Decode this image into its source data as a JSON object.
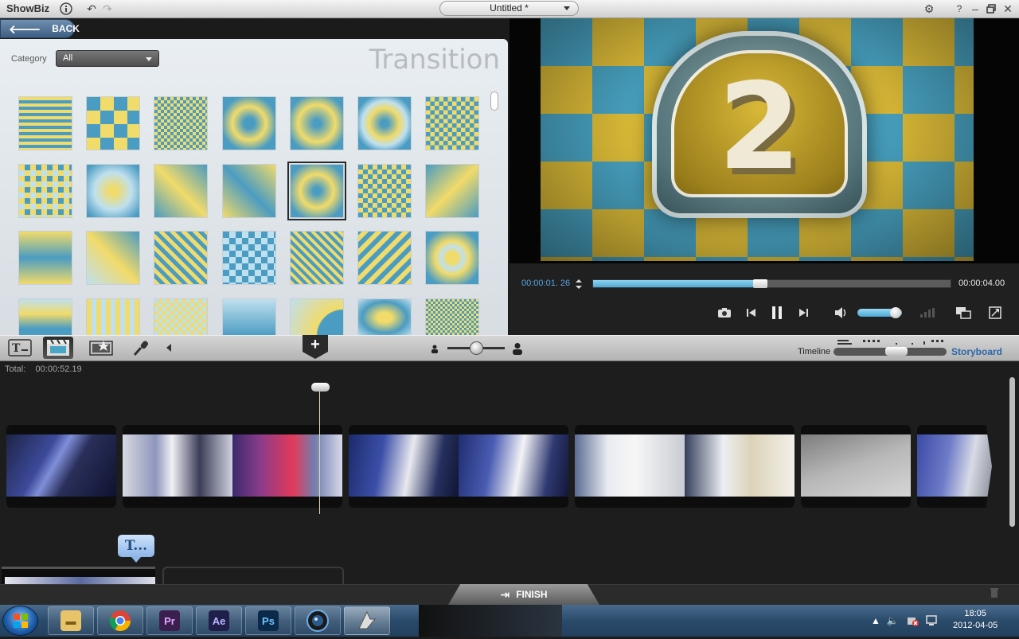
{
  "app": {
    "name": "ShowBiz",
    "document_title": "Untitled *"
  },
  "library": {
    "back_label": "BACK",
    "category_label": "Category",
    "category_value": "All",
    "section_title": "Transition",
    "thumbnails": [
      "horizontal-stripes",
      "checkerboard-large",
      "checkerboard-fine",
      "circle-radial",
      "square-iris",
      "circle-iris",
      "checker-dissolve",
      "random-blocks",
      "cross-diamond",
      "x-wipe",
      "x-wipe-2",
      "box-in-selected",
      "checker-small",
      "x-soft",
      "diamond-wipe",
      "x-cross",
      "diagonal-checker",
      "checker-soft",
      "diamond-lattice",
      "x-lattice",
      "nested-squares",
      "stripes-soft",
      "vertical-bars",
      "checker-tiny",
      "radial-soft",
      "page-peel",
      "burst",
      "pixel-dissolve"
    ],
    "selected_index": 11
  },
  "preview": {
    "countdown_digit": "2",
    "time_current": "00:00:01. 26",
    "time_total": "00:00:04.00",
    "progress": 0.46,
    "volume": 0.85
  },
  "toolbar": {
    "timeline_label": "Timeline",
    "storyboard_label": "Storyboard",
    "add_symbol": "+"
  },
  "timeline": {
    "total_label": "Total:",
    "total_value": "00:00:52.19",
    "title_track_symbol": "T..."
  },
  "bottom": {
    "finish_label": "FINISH"
  },
  "taskbar": {
    "apps": [
      {
        "name": "explorer",
        "glyph": "📁"
      },
      {
        "name": "chrome",
        "glyph": ""
      },
      {
        "name": "premiere",
        "glyph": "Pr"
      },
      {
        "name": "after-effects",
        "glyph": "Ae"
      },
      {
        "name": "photoshop",
        "glyph": "Ps"
      },
      {
        "name": "camera-app",
        "glyph": ""
      },
      {
        "name": "showbiz",
        "glyph": ""
      }
    ],
    "clock_time": "18:05",
    "clock_date": "2012-04-05"
  },
  "colors": {
    "accent_blue": "#4aa6c6",
    "accent_yellow": "#e2c039",
    "storyboard_blue": "#2c68a8"
  }
}
